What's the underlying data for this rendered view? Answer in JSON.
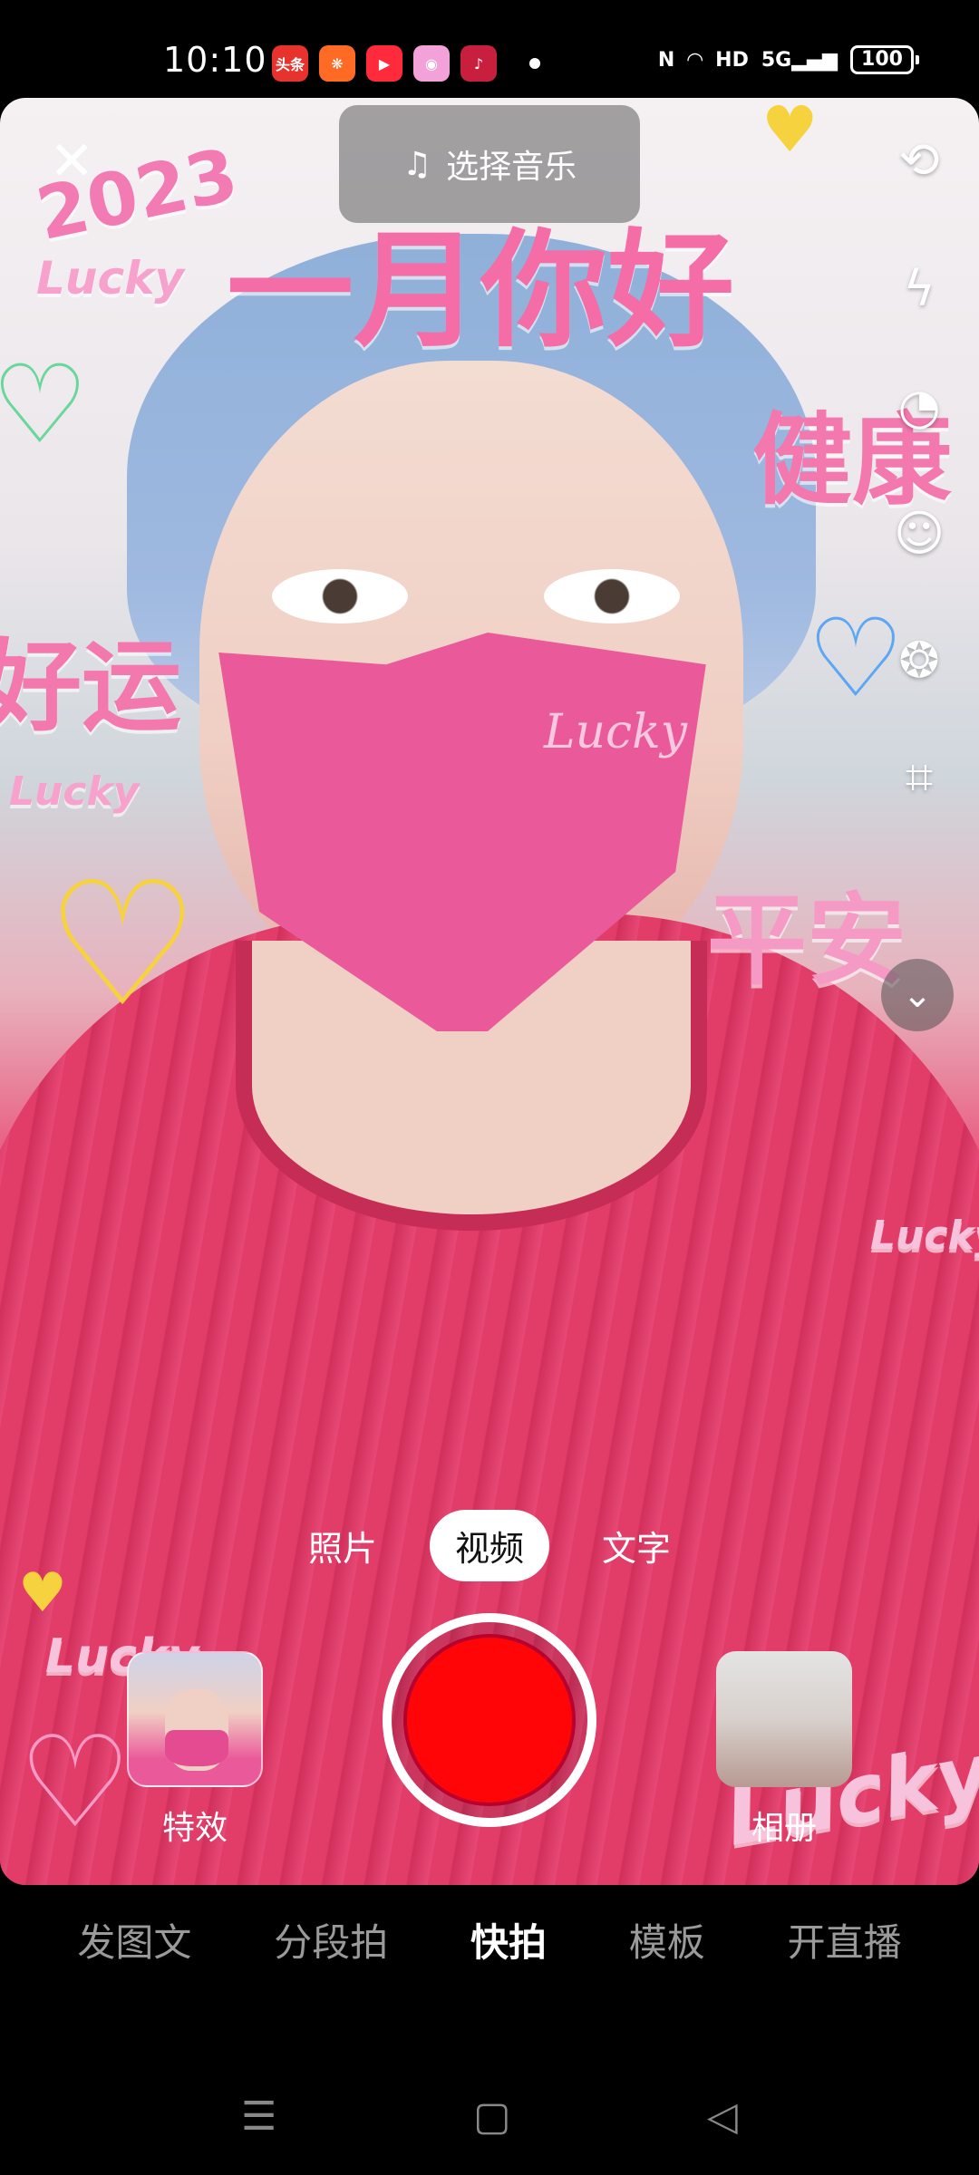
{
  "status_bar": {
    "time": "10:10",
    "apps": [
      {
        "name": "toutiao-app-icon",
        "label": "头条",
        "bg": "#e8322e"
      },
      {
        "name": "kuaishou-app-icon",
        "label": "",
        "bg": "#ff6a24"
      },
      {
        "name": "video-app-icon",
        "label": "",
        "bg": "#ff2b3d"
      },
      {
        "name": "gallery-app-icon",
        "label": "",
        "bg": "#f3a2d9"
      },
      {
        "name": "douyin-app-icon",
        "label": "",
        "bg": "#c91f3f"
      }
    ],
    "hd_label": "HD",
    "signal_label": "5G",
    "battery": "100"
  },
  "camera": {
    "music_button_label": "选择音乐",
    "sticker_texts": [
      "2023",
      "Lucky",
      "一月你好",
      "健康",
      "好运",
      "平安"
    ],
    "mask_text": "Lucky"
  },
  "capture_modes": [
    {
      "label": "照片",
      "active": false
    },
    {
      "label": "视频",
      "active": true
    },
    {
      "label": "文字",
      "active": false
    }
  ],
  "effects_label": "特效",
  "album_label": "相册",
  "bottom_tabs": [
    {
      "label": "发图文",
      "active": false
    },
    {
      "label": "分段拍",
      "active": false
    },
    {
      "label": "快拍",
      "active": true
    },
    {
      "label": "模板",
      "active": false
    },
    {
      "label": "开直播",
      "active": false
    }
  ],
  "colors": {
    "record": "#ff0508",
    "accent_pink": "#ea5a9a"
  }
}
